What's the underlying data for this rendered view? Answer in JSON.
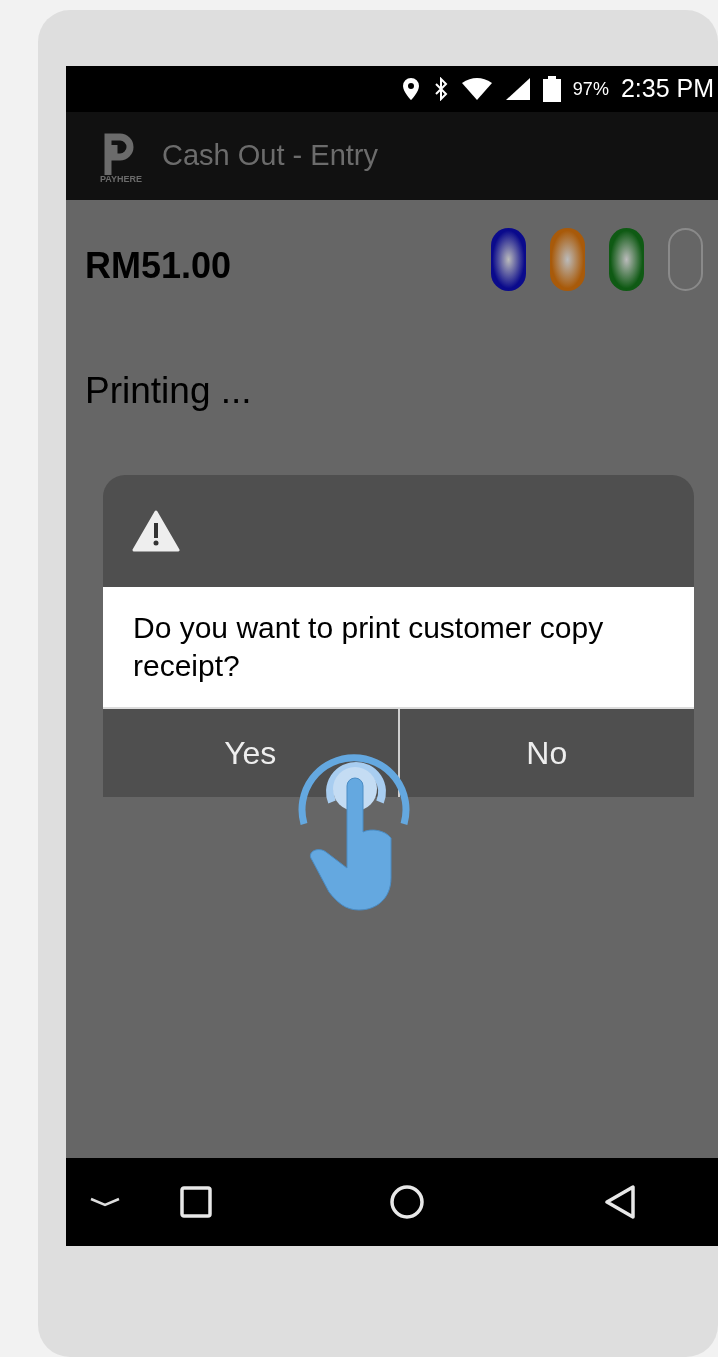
{
  "status_bar": {
    "battery": "97%",
    "time": "2:35 PM"
  },
  "app_bar": {
    "logo_text": "PAYHERE",
    "title": "Cash Out - Entry"
  },
  "amount": "RM51.00",
  "indicators": [
    {
      "color": "#0a0a8c",
      "on": true
    },
    {
      "color": "#a85a0a",
      "on": true
    },
    {
      "color": "#0f5a14",
      "on": true
    },
    {
      "color": "#8a8a8a",
      "on": false
    }
  ],
  "status_text": "Printing ...",
  "dialog": {
    "message": "Do you want to print customer copy receipt?",
    "buttons": [
      {
        "label": "Yes"
      },
      {
        "label": "No"
      }
    ]
  }
}
